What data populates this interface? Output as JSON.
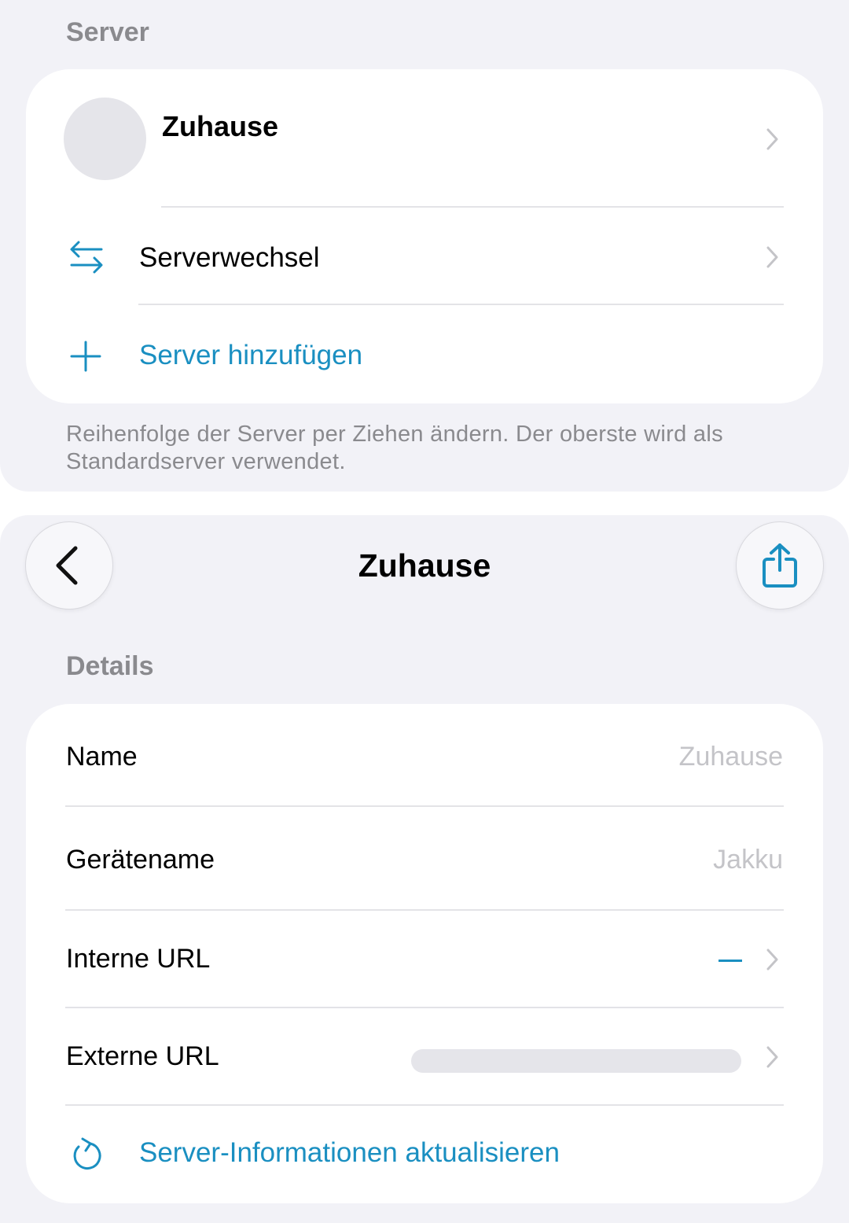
{
  "server_list": {
    "section_title": "Server",
    "current_server": {
      "name": "Zuhause"
    },
    "switch_label": "Serverwechsel",
    "add_label": "Server hinzufügen",
    "footer_note": "Reihenfolge der Server per Ziehen ändern. Der oberste wird als Standardserver verwendet."
  },
  "detail_view": {
    "title": "Zuhause",
    "section_title": "Details",
    "rows": {
      "name": {
        "label": "Name",
        "value": "Zuhause"
      },
      "device_name": {
        "label": "Gerätename",
        "value": "Jakku"
      },
      "internal_url": {
        "label": "Interne URL",
        "value": "—"
      },
      "external_url": {
        "label": "Externe URL"
      }
    },
    "refresh_label": "Server-Informationen aktualisieren"
  },
  "icons": {
    "switch": "arrows-exchange-icon",
    "add": "plus-icon",
    "back": "chevron-left-icon",
    "share": "share-icon",
    "refresh": "refresh-icon",
    "disclosure": "chevron-right-icon"
  },
  "colors": {
    "accent": "#1a8fc1",
    "background": "#f2f2f7",
    "card": "#ffffff",
    "secondary_text": "#8a8a8e",
    "placeholder_text": "#c4c4c8"
  }
}
